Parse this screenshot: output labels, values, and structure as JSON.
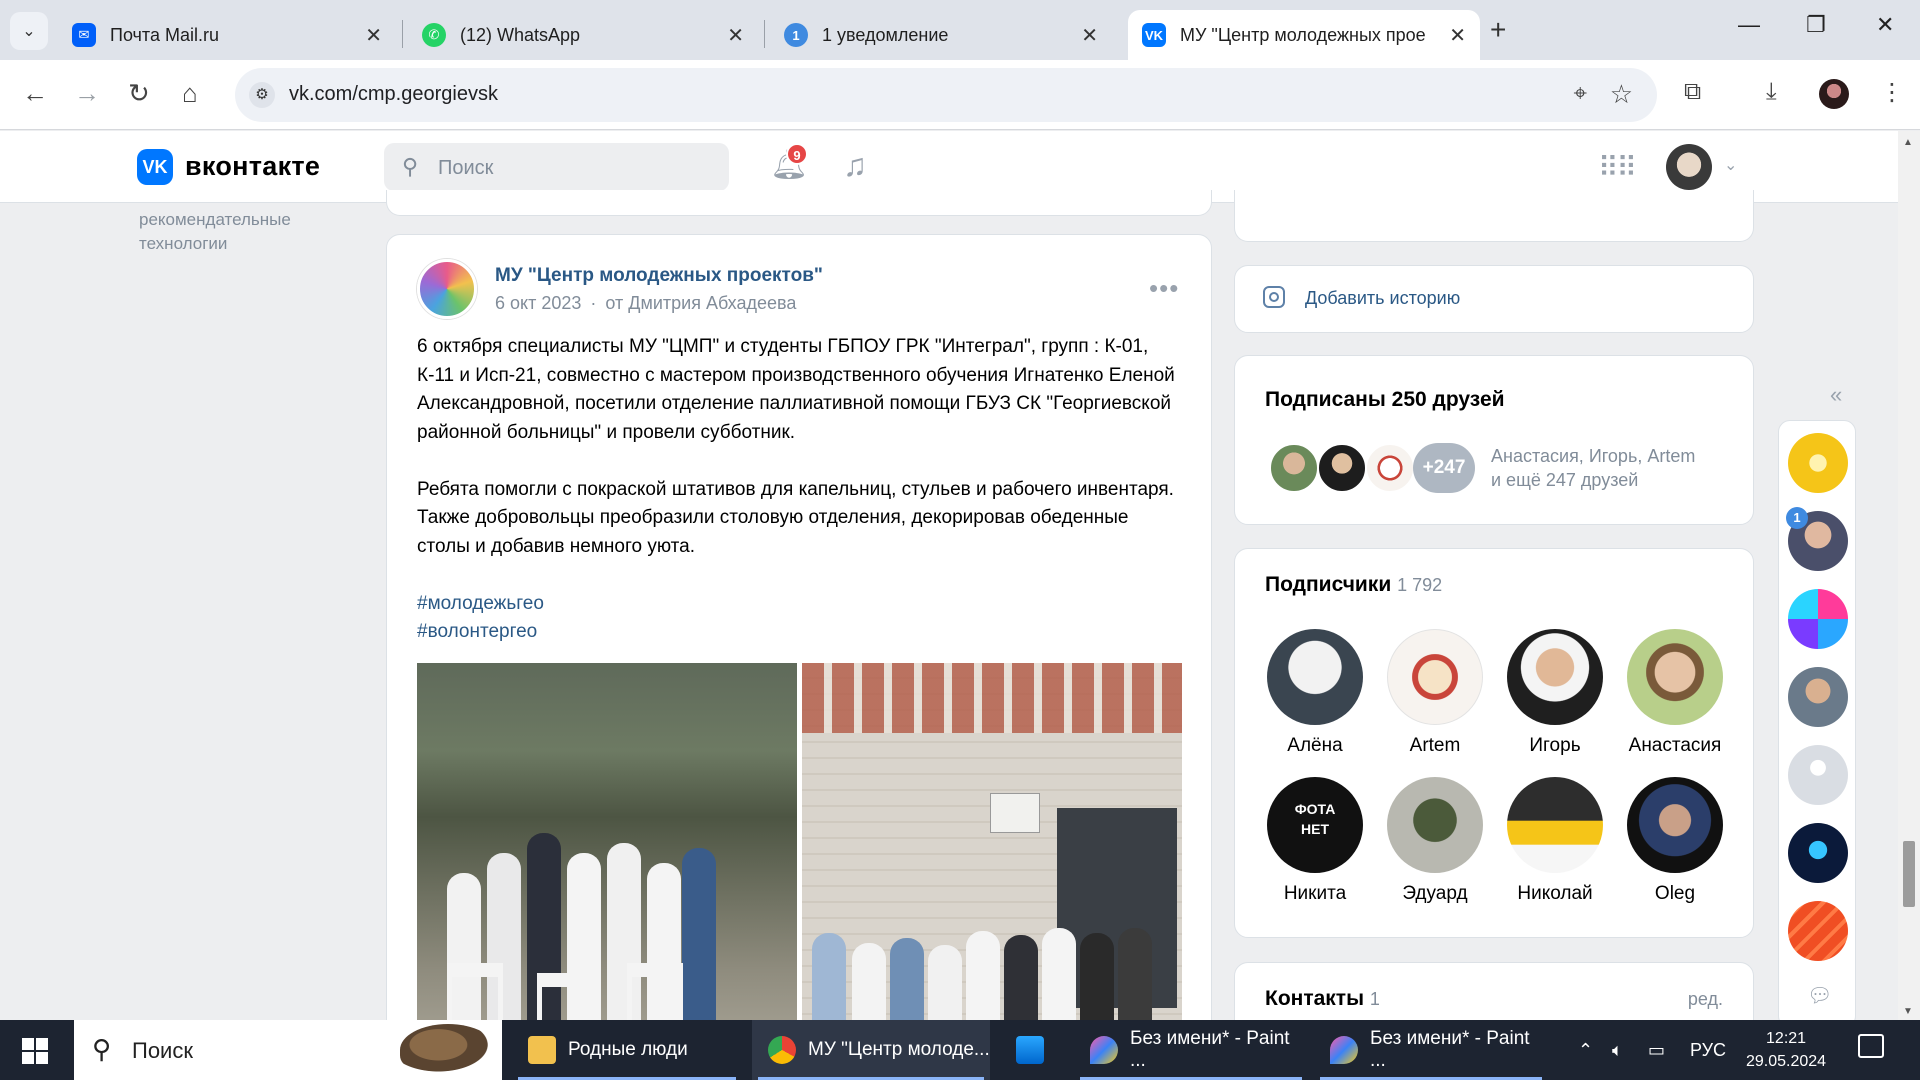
{
  "browser": {
    "tabs": [
      {
        "title": "Почта Mail.ru",
        "icon": "mail-icon",
        "color": "#005ff9"
      },
      {
        "title": "(12) WhatsApp",
        "icon": "whatsapp-icon",
        "color": "#25d366"
      },
      {
        "title": "1 уведомление",
        "icon": "notification-badge-icon",
        "badge": "1",
        "color": "#3f8ae0"
      },
      {
        "title": "МУ \"Центр молодежных прое",
        "icon": "vk-icon",
        "color": "#0077ff",
        "active": true
      }
    ],
    "url": "vk.com/cmp.georgievsk"
  },
  "vk": {
    "logo_text": "вконтакте",
    "logo_mark": "VK",
    "search_placeholder": "Поиск",
    "notifications_count": "9"
  },
  "left_menu": [
    "рекомендательные",
    "технологии"
  ],
  "post": {
    "author": "МУ \"Центр молодежных проектов\"",
    "date": "6 окт 2023",
    "separator": "·",
    "by": "от Дмитрия Абхадеева",
    "paragraphs": [
      "6 октября специалисты МУ \"ЦМП\" и студенты ГБПОУ ГРК \"Интеграл\", групп : К-01, К-11 и Исп-21, совместно с мастером производственного обучения Игнатенко Еленой Александровной, посетили отделение паллиативной помощи ГБУЗ СК \"Георгиевской районной больницы\" и провели субботник.",
      "Ребята помогли с покраской штативов для капельниц, стульев и рабочего инвентаря. Также добровольцы преобразили столовую отделения, декорировав обеденные столы и добавив немного уюта."
    ],
    "hashtags": [
      "#молодежьгео",
      "#волонтергео"
    ]
  },
  "story": {
    "label": "Добавить историю"
  },
  "friends": {
    "title": "Подписаны 250 друзей",
    "more": "+247",
    "names_line1": "Анастасия, Игорь, Artem",
    "names_line2": "и ещё 247 друзей"
  },
  "subscribers": {
    "title": "Подписчики",
    "count": "1 792",
    "people": [
      "Алёна",
      "Artem",
      "Игорь",
      "Анастасия",
      "Никита",
      "Эдуард",
      "Николай",
      "Oleg"
    ]
  },
  "contacts": {
    "title": "Контакты",
    "count": "1",
    "edit": "ред."
  },
  "taskbar": {
    "search_placeholder": "Поиск",
    "apps": [
      "Родные люди",
      "МУ \"Центр молоде...",
      "Без имени* - Paint ...",
      "Без имени* - Paint ..."
    ],
    "language": "РУС",
    "time": "12:21",
    "date": "29.05.2024"
  }
}
